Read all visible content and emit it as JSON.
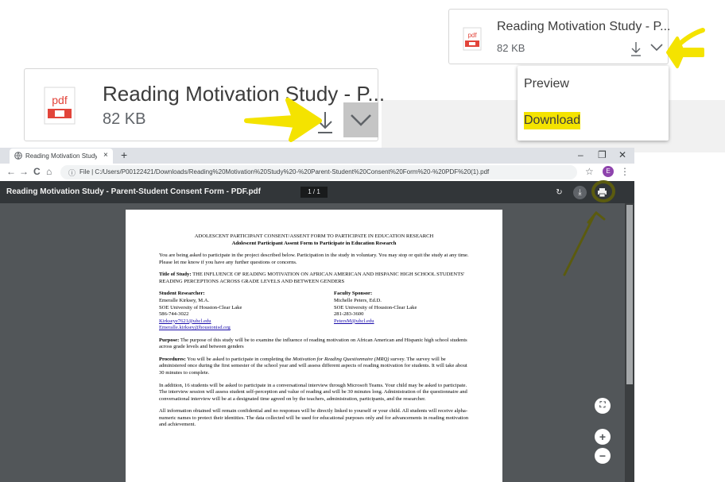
{
  "download_chip_large": {
    "file_name": "Reading Motivation Study - P...",
    "file_size": "82 KB"
  },
  "download_chip_small": {
    "file_name": "Reading Motivation Study - P...",
    "file_size": "82 KB"
  },
  "download_menu": {
    "preview_label": "Preview",
    "download_label": "Download"
  },
  "browser": {
    "tab_title": "Reading Motivation Study - Paren",
    "tab_close": "×",
    "new_tab": "+",
    "window_controls": [
      "–",
      "❐",
      "✕"
    ],
    "nav": {
      "back": "←",
      "forward": "→",
      "reload": "C",
      "home": "⌂"
    },
    "url_prefix": "File",
    "url": "C:/Users/P00122421/Downloads/Reading%20Motivation%20Study%20-%20Parent-Student%20Consent%20Form%20-%20PDF%20(1).pdf",
    "profile_initial": "E"
  },
  "viewer": {
    "title": "Reading Motivation Study - Parent-Student Consent Form - PDF.pdf",
    "page_indicator": "1  /  1"
  },
  "document": {
    "heading1": "ADOLESCENT PARTICIPANT CONSENT/ASSENT FORM TO PARTICIPATE IN EDUCATION RESEARCH",
    "heading2": "Adolescent Participant Assent Form to Participate in Education Research",
    "intro": "You are being asked to participate in the project described below. Participation in the study in voluntary. You may stop or quit the study at any time. Please let me know if you have any further questions or concerns.",
    "title_label": "Title of Study:",
    "title_text": "THE INFLUENCE OF READING MOTIVATION ON AFRICAN AMERICAN AND HISPANIC HIGH SCHOOL STUDENTS' READING PERCEPTIONS ACROSS GRADE LEVELS AND BETWEEN GENDERS",
    "researcher": {
      "label": "Student Researcher:",
      "name": "Emeralle Kirksey, M.A.",
      "org": "SOE University of Houston-Clear Lake",
      "phone": "586-744-3022",
      "email1": "Kirkseye7621@uhcl.edu",
      "email2": "Emeralle.kirksey@houstonisd.org"
    },
    "sponsor": {
      "label": "Faculty Sponsor:",
      "name": "Michelle Peters, Ed.D.",
      "org": "SOE University of Houston-Clear Lake",
      "phone": "281-283-3600",
      "email": "PetersM@uhcl.edu"
    },
    "purpose_label": "Purpose:",
    "purpose_text": "The purpose of this study will be to examine the influence of reading motivation on African American and Hispanic high school students across grade levels and between genders",
    "procedures_label": "Procedures:",
    "procedures_text_a": "You will be asked to participate in completing the",
    "procedures_italic": "Motivation for Reading Questionnaire (MRQ)",
    "procedures_text_b": "survey. The survey will be administered once during the first semester of the school year and will assess different aspects of reading motivation for students. It will take about 30 minutes to complete.",
    "interview": "In addition, 16 students will be asked to participate in a conversational interview through Microsoft Teams. Your child may be asked to participate. The interview session will assess student self-perception and value of reading and will be 30 minutes long. Administration of the questionnaire and conversational interview will be at a designated time agreed on by the teachers, administration, participants, and the researcher.",
    "confidential": "All information obtained will remain confidential and no responses will be directly linked to yourself or your child. All students will receive alpha-numeric names to protect their identities. The data collected will be used for educational purposes only and for advancements in reading motivation and achievement."
  },
  "colors": {
    "highlight": "#f4e300",
    "annotation_olive": "#5b5b0f",
    "viewer_bg": "#525659",
    "viewer_bar": "#323639"
  }
}
